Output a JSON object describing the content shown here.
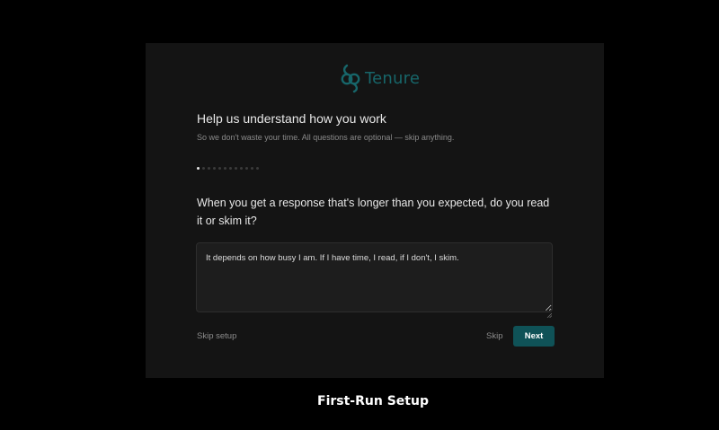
{
  "app": {
    "brand_name": "Tenure",
    "logo_icon": "knot-icon",
    "accent_color": "#0f5257"
  },
  "setup": {
    "heading": "Help us understand how you work",
    "subheading": "So we don't waste your time. All questions are optional — skip anything.",
    "progress": {
      "current_step": 1,
      "total_steps": 12
    },
    "question": "When you get a response that's longer than you expected, do you read it or skim it?",
    "answer_value": "It depends on how busy I am. If I have time, I read, if I don't, I skim.",
    "skip_setup_label": "Skip setup",
    "skip_label": "Skip",
    "next_label": "Next"
  },
  "caption": "First-Run Setup"
}
